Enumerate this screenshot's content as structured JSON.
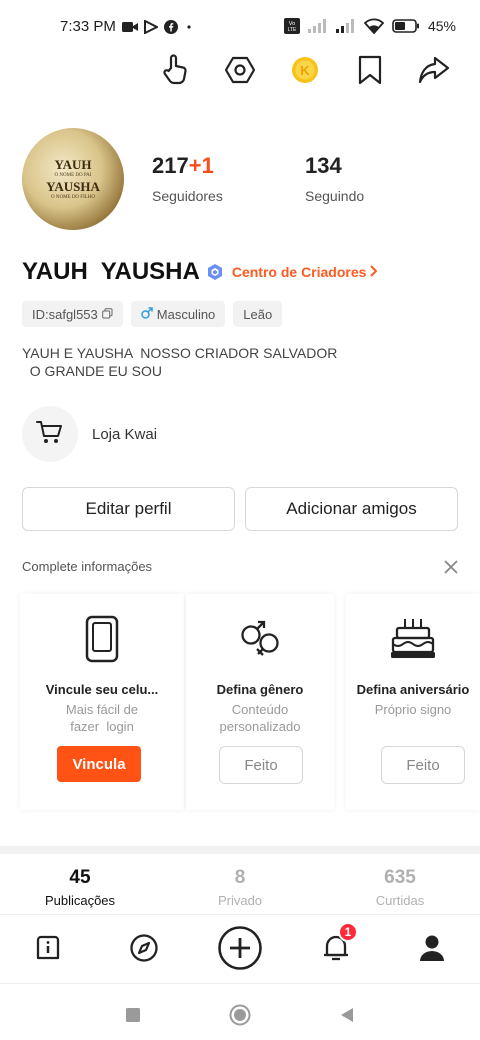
{
  "status_bar": {
    "time": "7:33 PM",
    "battery": "45%",
    "volte": "Vo LTE"
  },
  "top_icons": [
    "hand-pointer-icon",
    "settings-hexagon-icon",
    "coin-icon",
    "bookmark-icon",
    "share-icon"
  ],
  "profile": {
    "avatar_lines": [
      "YAUH",
      "O NOME DO PAI",
      "YAUSHA",
      "O NOME DO FILHO"
    ],
    "followers_count": "217",
    "followers_delta": "+1",
    "followers_label": "Seguidores",
    "following_count": "134",
    "following_label": "Seguindo",
    "username": "YAUH  YAUSHA",
    "creator_link": "Centro de Criadores",
    "tags": {
      "id": "ID:safgl553",
      "gender": "Masculino",
      "sign": "Leão"
    },
    "bio": "YAUH E YAUSHA  NOSSO CRIADOR SALVADOR\n  O GRANDE EU SOU",
    "shop_label": "Loja Kwai"
  },
  "actions": {
    "edit_profile": "Editar perfil",
    "add_friends": "Adicionar amigos"
  },
  "complete_info": {
    "title": "Complete informações",
    "cards": [
      {
        "title": "Vincule seu celu...",
        "desc": "Mais fácil de\nfazer  login",
        "button": "Vincula"
      },
      {
        "title": "Defina gênero",
        "desc": "Conteúdo\npersonalizado",
        "button": "Feito"
      },
      {
        "title": "Defina aniversário",
        "desc": "Próprio signo",
        "button": "Feito"
      }
    ]
  },
  "tabs": [
    {
      "count": "45",
      "label": "Publicações",
      "active": true
    },
    {
      "count": "8",
      "label": "Privado",
      "active": false
    },
    {
      "count": "635",
      "label": "Curtidas",
      "active": false
    }
  ],
  "bottom_nav": {
    "notification_badge": "1"
  },
  "colors": {
    "accent": "#fe5314",
    "creator_link": "#ff5a1f",
    "badge": "#ff2b3a"
  }
}
